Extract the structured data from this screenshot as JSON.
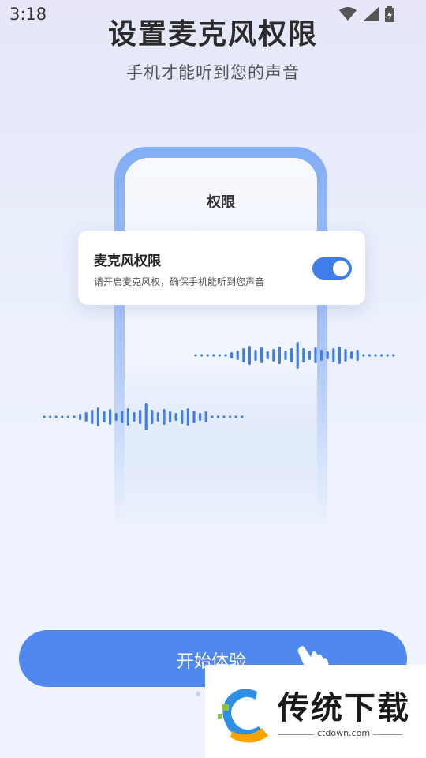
{
  "status_bar": {
    "time": "3:18",
    "icons": [
      "wifi-icon",
      "signal-icon",
      "battery-charging-icon"
    ]
  },
  "header": {
    "title": "设置麦克风权限",
    "subtitle": "手机才能听到您的声音"
  },
  "phone": {
    "screen_title": "权限"
  },
  "permission_card": {
    "title": "麦克风权限",
    "description": "请开启麦克风权，确保手机能听到您声音",
    "toggle_on": true
  },
  "colors": {
    "accent": "#3f7ee9",
    "button": "#5088ee",
    "wave": "#3f7ee9"
  },
  "start_button": {
    "label": "开始体验",
    "icon": "hand-pointer-icon"
  },
  "pager": {
    "count": 3
  },
  "watermark": {
    "brand": "传统下载",
    "url": "ctdown.com"
  }
}
